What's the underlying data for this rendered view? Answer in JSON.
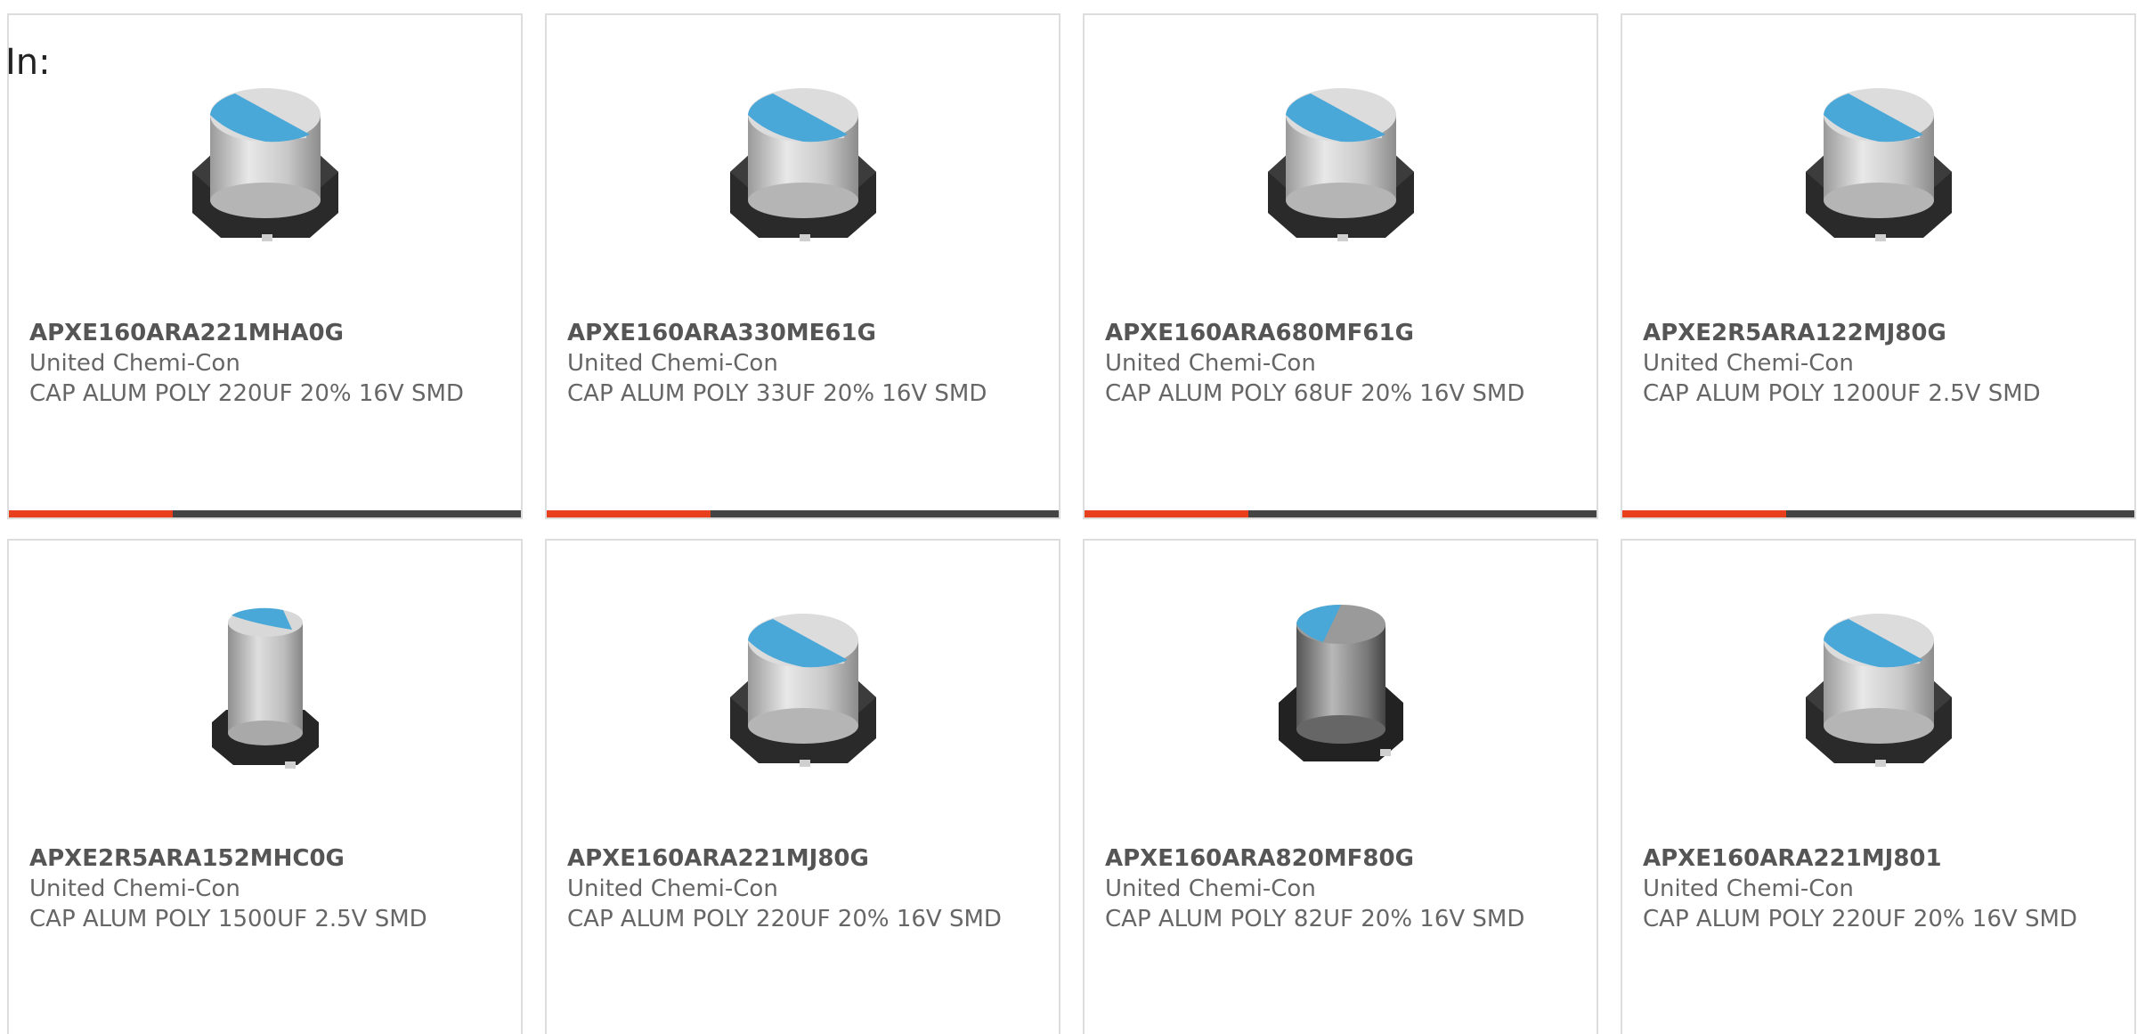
{
  "label": "In:",
  "colors": {
    "accent": "#e8401c",
    "bar": "#444444",
    "border": "#dddddd",
    "cap_top": "#4aa8d8"
  },
  "products": [
    {
      "part": "APXE160ARA221MHA0G",
      "manufacturer": "United Chemi-Con",
      "description": "CAP ALUM POLY 220UF 20% 16V SMD",
      "image": "capacitor-wide-icon"
    },
    {
      "part": "APXE160ARA330ME61G",
      "manufacturer": "United Chemi-Con",
      "description": "CAP ALUM POLY 33UF 20% 16V SMD",
      "image": "capacitor-wide-icon"
    },
    {
      "part": "APXE160ARA680MF61G",
      "manufacturer": "United Chemi-Con",
      "description": "CAP ALUM POLY 68UF 20% 16V SMD",
      "image": "capacitor-wide-icon"
    },
    {
      "part": "APXE2R5ARA122MJ80G",
      "manufacturer": "United Chemi-Con",
      "description": "CAP ALUM POLY 1200UF 2.5V SMD",
      "image": "capacitor-wide-icon"
    },
    {
      "part": "APXE2R5ARA152MHC0G",
      "manufacturer": "United Chemi-Con",
      "description": "CAP ALUM POLY 1500UF 2.5V SMD",
      "image": "capacitor-tall-icon"
    },
    {
      "part": "APXE160ARA221MJ80G",
      "manufacturer": "United Chemi-Con",
      "description": "CAP ALUM POLY 220UF 20% 16V SMD",
      "image": "capacitor-wide-icon"
    },
    {
      "part": "APXE160ARA820MF80G",
      "manufacturer": "United Chemi-Con",
      "description": "CAP ALUM POLY 82UF 20% 16V SMD",
      "image": "capacitor-dark-icon"
    },
    {
      "part": "APXE160ARA221MJ801",
      "manufacturer": "United Chemi-Con",
      "description": "CAP ALUM POLY 220UF 20% 16V SMD",
      "image": "capacitor-wide-icon"
    }
  ]
}
